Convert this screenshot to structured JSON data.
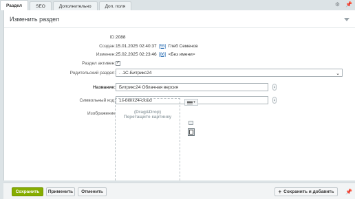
{
  "tabs": [
    {
      "label": "Раздел",
      "active": true
    },
    {
      "label": "SEO",
      "active": false
    },
    {
      "label": "Дополнительно",
      "active": false
    },
    {
      "label": "Доп. поля",
      "active": false
    }
  ],
  "tab_tools": {
    "settings_icon": "gear-icon",
    "pin_icon": "pin-icon"
  },
  "panel": {
    "title": "Изменить раздел"
  },
  "fields": {
    "id": {
      "label": "ID:",
      "value": "2088"
    },
    "created": {
      "label": "Создан:",
      "date": "15.01.2025 02:40:37",
      "user_id": "[55]",
      "user_name": "Глеб Семенов"
    },
    "modified": {
      "label": "Изменен:",
      "date": "25.02.2025 02:23:46",
      "user_id": "[86]",
      "user_name": "<Без имени>"
    },
    "active": {
      "label": "Раздел активен:",
      "checked": true,
      "mark": "✓"
    },
    "parent": {
      "label": "Родительский раздел:",
      "value": ". .1С-Битрикс24"
    },
    "name": {
      "label": "Название:",
      "value": "Битрикс24 Облачная версия"
    },
    "code": {
      "label": "Символьный код:",
      "value": "1s-bitrix24-cloud"
    },
    "image": {
      "label": "Изображение",
      "drop_line1": "(Drag&Drop)",
      "drop_line2": "Перетащите картинку"
    }
  },
  "footer": {
    "save": "Сохранить",
    "apply": "Применить",
    "cancel": "Отменить",
    "save_add": "Сохранить и добавить"
  },
  "colors": {
    "primary": "#86ad00",
    "link": "#2067b0",
    "background": "#dce3e6"
  }
}
